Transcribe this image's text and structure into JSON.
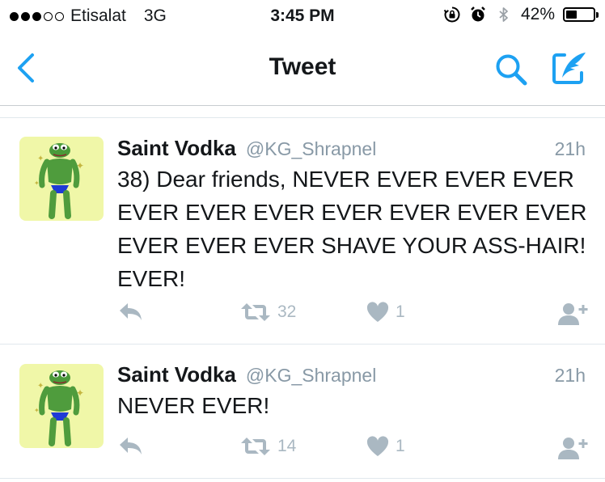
{
  "status_bar": {
    "carrier": "Etisalat",
    "network": "3G",
    "time": "3:45 PM",
    "battery_percent": "42%",
    "battery_level": 0.42,
    "signal_bars_filled": 3,
    "signal_bars_total": 5
  },
  "nav": {
    "title": "Tweet",
    "accent_color": "#1da1f2"
  },
  "tweets": [
    {
      "name": "Saint Vodka",
      "handle": "@KG_Shrapnel",
      "time": "21h",
      "text": "38) Dear friends, NEVER EVER EVER EVER EVER EVER EVER EVER EVER EVER EVER EVER EVER EVER SHAVE YOUR ASS-HAIR! EVER!",
      "retweets": "32",
      "likes": "1"
    },
    {
      "name": "Saint Vodka",
      "handle": "@KG_Shrapnel",
      "time": "21h",
      "text": "NEVER EVER!",
      "retweets": "14",
      "likes": "1"
    }
  ],
  "icons": {
    "back": "chevron-left-icon",
    "search": "search-icon",
    "compose": "compose-icon",
    "reply": "reply-icon",
    "retweet": "retweet-icon",
    "like": "heart-icon",
    "follow": "follow-icon"
  }
}
